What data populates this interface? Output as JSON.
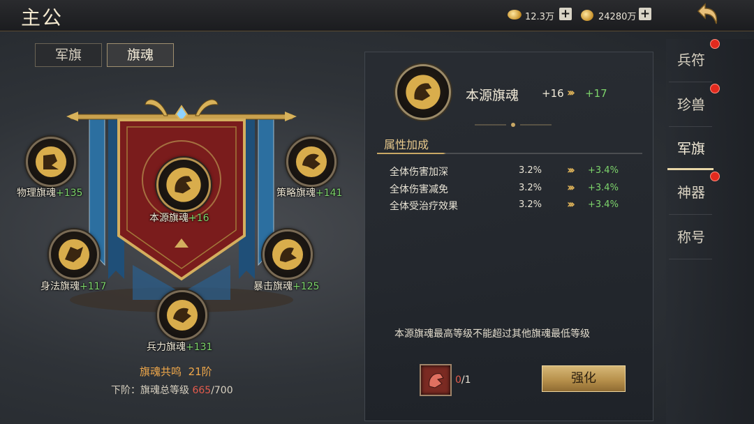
{
  "header": {
    "title": "主公",
    "currency1_value": "12.3万",
    "currency2_value": "24280万",
    "plus_label": "+"
  },
  "tabs": [
    {
      "label": "军旗"
    },
    {
      "label": "旗魂",
      "active": true
    }
  ],
  "nodes": [
    {
      "name": "物理旗魂",
      "bonus": "+135"
    },
    {
      "name": "策略旗魂",
      "bonus": "+141"
    },
    {
      "name": "本源旗魂",
      "bonus": "+16"
    },
    {
      "name": "身法旗魂",
      "bonus": "+117"
    },
    {
      "name": "暴击旗魂",
      "bonus": "+125"
    },
    {
      "name": "兵力旗魂",
      "bonus": "+131"
    }
  ],
  "resonance": {
    "label": "旗魂共鸣",
    "tier": "21阶",
    "next_prefix": "下阶：",
    "next_label": "旗魂总等级",
    "current": "665",
    "target": "/700"
  },
  "detail": {
    "name": "本源旗魂",
    "current_level": "+16",
    "next_level": "+17",
    "attr_section_title": "属性加成",
    "attributes": [
      {
        "name": "全体伤害加深",
        "value": "3.2%",
        "next": "+3.4%"
      },
      {
        "name": "全体伤害减免",
        "value": "3.2%",
        "next": "+3.4%"
      },
      {
        "name": "全体受治疗效果",
        "value": "3.2%",
        "next": "+3.4%"
      }
    ],
    "notice": "本源旗魂最高等级不能超过其他旗魂最低等级",
    "item_have": "0",
    "item_need": "/1",
    "enhance_label": "强化"
  },
  "sidenav": [
    {
      "label": "兵符",
      "badge": true
    },
    {
      "label": "珍兽",
      "badge": true
    },
    {
      "label": "军旗",
      "badge": false,
      "active": true
    },
    {
      "label": "神器",
      "badge": true
    },
    {
      "label": "称号",
      "badge": false
    }
  ],
  "colors": {
    "accent_gold": "#c9a865",
    "increase_green": "#7dd56b",
    "warning_red": "#e35b4c",
    "badge_red": "#e32a1e"
  }
}
